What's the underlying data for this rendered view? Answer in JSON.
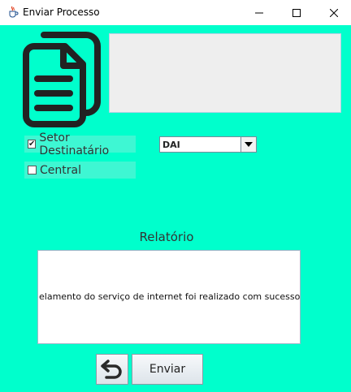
{
  "window": {
    "title": "Enviar Processo"
  },
  "form": {
    "setor_label": "Setor Destinatário",
    "setor_checked": true,
    "central_label": "Central",
    "central_checked": false,
    "setor_select_value": "DAI",
    "relatorio_label": "Relatório",
    "relatorio_text": "elamento do serviço de internet foi realizado com sucesso",
    "send_button_label": "Enviar"
  },
  "icons": {
    "app": "java-cup-icon",
    "document": "documents-copy-icon",
    "back": "undo-arrow-icon",
    "dropdown": "chevron-down-icon"
  },
  "colors": {
    "background": "#00ffcc",
    "checkbox_row_background": "#3ef7d3",
    "document_icon": "#222222"
  }
}
